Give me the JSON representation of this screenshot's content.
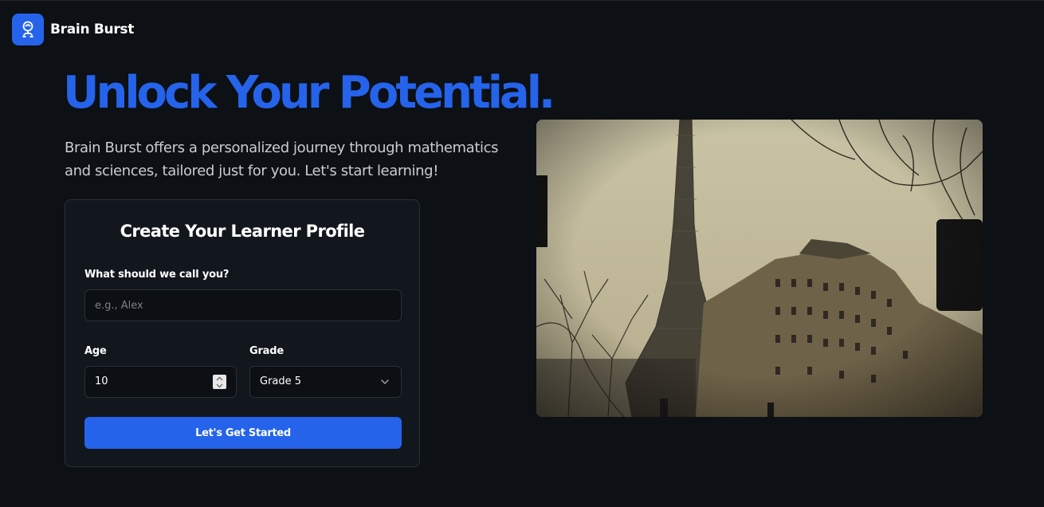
{
  "header": {
    "brand_name": "Brain Burst",
    "logo_icon": "brain-icon"
  },
  "hero": {
    "title": "Unlock Your Potential.",
    "subtitle": "Brain Burst offers a personalized journey through mathematics and sciences, tailored just for you. Let's start learning!"
  },
  "profile_form": {
    "title": "Create Your Learner Profile",
    "name_label": "What should we call you?",
    "name_placeholder": "e.g., Alex",
    "name_value": "",
    "age_label": "Age",
    "age_value": "10",
    "grade_label": "Grade",
    "grade_value": "Grade 5",
    "submit_label": "Let's Get Started"
  },
  "photo": {
    "subject": "eiffel-tower-paris-street-photo"
  },
  "colors": {
    "accent": "#2563eb",
    "background": "#0d1014",
    "card": "#12161d",
    "text_muted": "#c9ccd2"
  }
}
